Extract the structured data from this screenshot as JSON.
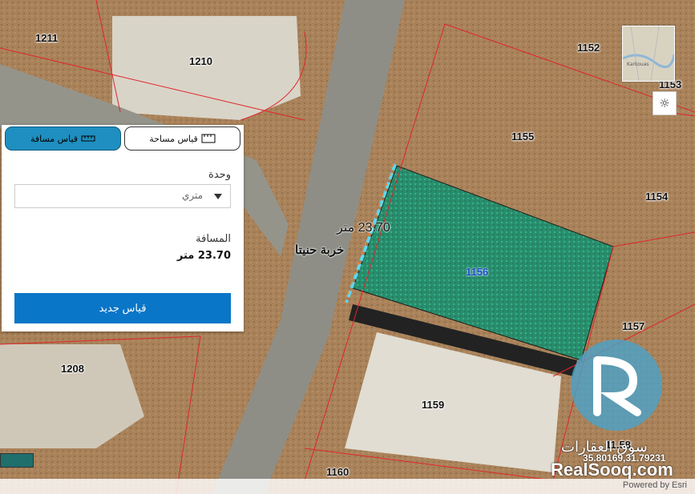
{
  "map": {
    "parcels": [
      {
        "id": "p1211",
        "label": "1211"
      },
      {
        "id": "p1210",
        "label": "1210"
      },
      {
        "id": "p1152",
        "label": "1152"
      },
      {
        "id": "p1153",
        "label": "1153"
      },
      {
        "id": "p1155",
        "label": "1155"
      },
      {
        "id": "p1154",
        "label": "1154"
      },
      {
        "id": "p1156",
        "label": "1156"
      },
      {
        "id": "p1157",
        "label": "1157"
      },
      {
        "id": "p1208",
        "label": "1208"
      },
      {
        "id": "p1159",
        "label": "1159"
      },
      {
        "id": "p1158",
        "label": "11.58"
      },
      {
        "id": "p1160",
        "label": "1160"
      }
    ],
    "measurement_label": "23.70 متر",
    "place_name": "خربة حنيتا",
    "coordinates": "35.80169,31.79231",
    "attribution": "Powered by Esri"
  },
  "panel": {
    "tab_distance": "قياس مسافة",
    "tab_area": "قياس مساحة",
    "unit_label": "وحدة",
    "unit_value": "متري",
    "distance_label": "المسافة",
    "distance_value": "23.70 متر",
    "new_button": "قياس جديد"
  },
  "overview": {
    "place": "Karkouas"
  },
  "watermark": {
    "brand_ar": "سوق العقارات",
    "brand_en": "RealSooq.com"
  },
  "colors": {
    "accent": "#0a76c7",
    "tab_active": "#1e8fc0",
    "parcel_line": "#e0262a",
    "highlight": "#27c4a8"
  }
}
